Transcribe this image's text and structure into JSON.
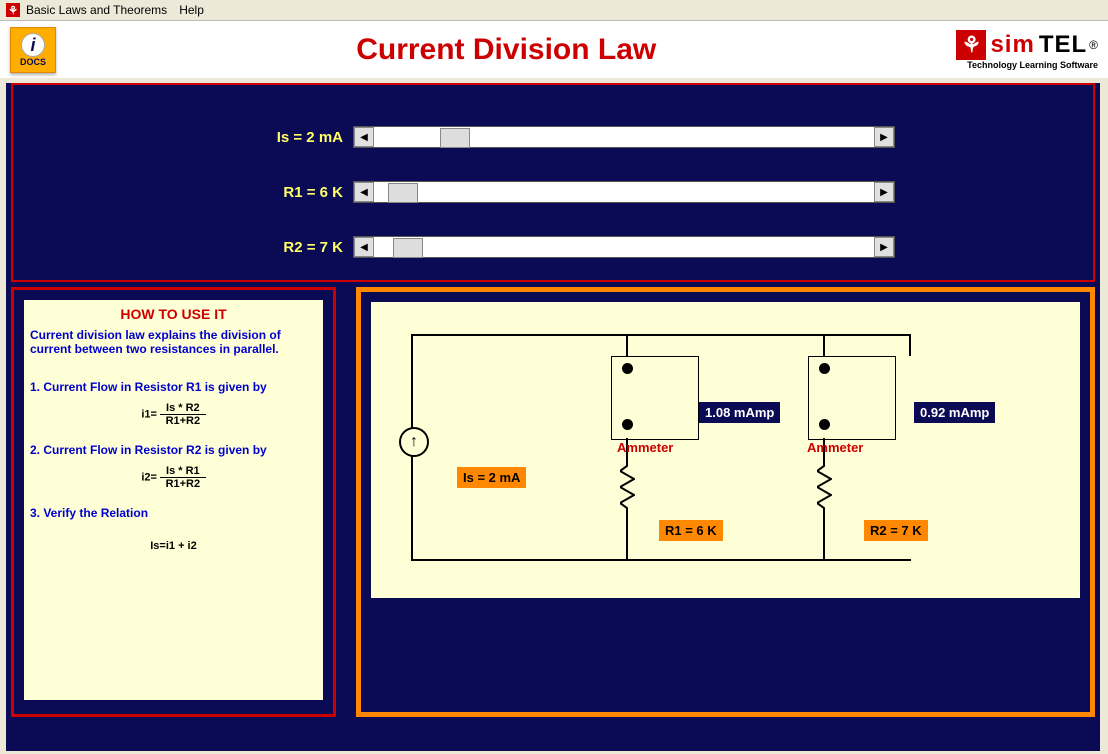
{
  "menu": {
    "title": "Basic Laws and Theorems",
    "help": "Help"
  },
  "header": {
    "docs_label": "DOCS",
    "page_title": "Current Division Law",
    "logo_sim": "sim",
    "logo_tel": "TEL",
    "logo_reg": "®",
    "logo_tag": "Technology Learning  Software"
  },
  "params": {
    "is": {
      "label": "Is =  2 mA",
      "thumb_pct": 14
    },
    "r1": {
      "label": "R1 =  6 K",
      "thumb_pct": 3
    },
    "r2": {
      "label": "R2 =  7 K",
      "thumb_pct": 4
    }
  },
  "howto": {
    "title": "HOW TO USE IT",
    "desc": "Current division law explains the division of current between two resistances in parallel.",
    "step1": "1. Current Flow in Resistor R1 is given by",
    "formula1_lhs": "i1=",
    "formula1_num": "Is * R2",
    "formula1_den": "R1+R2",
    "step2": "2. Current Flow in Resistor R2 is given by",
    "formula2_lhs": "i2=",
    "formula2_num": "Is * R1",
    "formula2_den": "R1+R2",
    "step3": "3. Verify the Relation",
    "relation": "Is=i1 + i2"
  },
  "diagram": {
    "is_label": "Is = 2 mA",
    "r1_label": "R1 = 6 K",
    "r2_label": "R2 = 7 K",
    "ammeter1_label": "Ammeter",
    "ammeter2_label": "Ammeter",
    "ammeter1_value": "1.08 mAmp",
    "ammeter2_value": "0.92 mAmp"
  },
  "glyphs": {
    "left_arrow": "◀",
    "right_arrow": "▶"
  }
}
